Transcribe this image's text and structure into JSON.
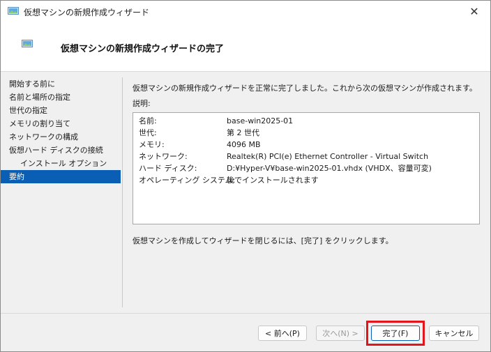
{
  "window": {
    "title": "仮想マシンの新規作成ウィザード",
    "close_glyph": "✕"
  },
  "header": {
    "title": "仮想マシンの新規作成ウィザードの完了"
  },
  "sidebar": {
    "items": [
      {
        "label": "開始する前に"
      },
      {
        "label": "名前と場所の指定"
      },
      {
        "label": "世代の指定"
      },
      {
        "label": "メモリの割り当て"
      },
      {
        "label": "ネットワークの構成"
      },
      {
        "label": "仮想ハード ディスクの接続"
      },
      {
        "label": "インストール オプション"
      },
      {
        "label": "要約"
      }
    ],
    "active_index": 7
  },
  "main": {
    "intro": "仮想マシンの新規作成ウィザードを正常に完了しました。これから次の仮想マシンが作成されます。",
    "desc_label": "説明:",
    "summary": [
      {
        "key": "名前:",
        "value": "base-win2025-01"
      },
      {
        "key": "世代:",
        "value": "第 2 世代"
      },
      {
        "key": "メモリ:",
        "value": "4096 MB"
      },
      {
        "key": "ネットワーク:",
        "value": "Realtek(R) PCI(e) Ethernet Controller - Virtual Switch"
      },
      {
        "key": "ハード ディスク:",
        "value": "D:¥Hyper-V¥base-win2025-01.vhdx (VHDX、容量可変)"
      },
      {
        "key": "オペレーティング システム:",
        "value": "後でインストールされます"
      }
    ],
    "finish_note": "仮想マシンを作成してウィザードを閉じるには、[完了] をクリックします。"
  },
  "buttons": {
    "back": "< 前へ(P)",
    "next": "次へ(N) >",
    "finish": "完了(F)",
    "cancel": "キャンセル"
  },
  "colors": {
    "accent": "#0a5fb4",
    "highlight": "#e3141b"
  }
}
